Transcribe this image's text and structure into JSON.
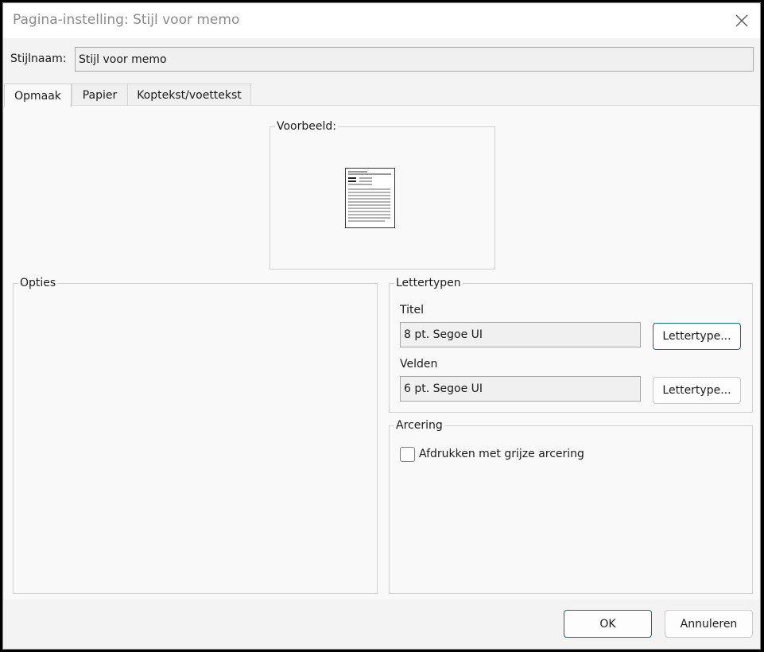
{
  "window": {
    "title": "Pagina-instelling: Stijl voor memo",
    "close_icon": "close-icon"
  },
  "style_name": {
    "label": "Stijlnaam:",
    "value": "Stijl voor memo"
  },
  "tabs": [
    {
      "label": "Opmaak",
      "active": true
    },
    {
      "label": "Papier",
      "active": false
    },
    {
      "label": "Koptekst/voettekst",
      "active": false
    }
  ],
  "preview": {
    "label": "Voorbeeld:"
  },
  "options": {
    "label": "Opties"
  },
  "fonts": {
    "label": "Lettertypen",
    "title_label": "Titel",
    "title_value": "8 pt. Segoe UI",
    "title_button": "Lettertype...",
    "fields_label": "Velden",
    "fields_value": "6 pt. Segoe UI",
    "fields_button": "Lettertype..."
  },
  "shading": {
    "label": "Arcering",
    "checkbox_label": "Afdrukken met grijze arcering",
    "checked": false
  },
  "footer": {
    "ok": "OK",
    "cancel": "Annuleren"
  }
}
